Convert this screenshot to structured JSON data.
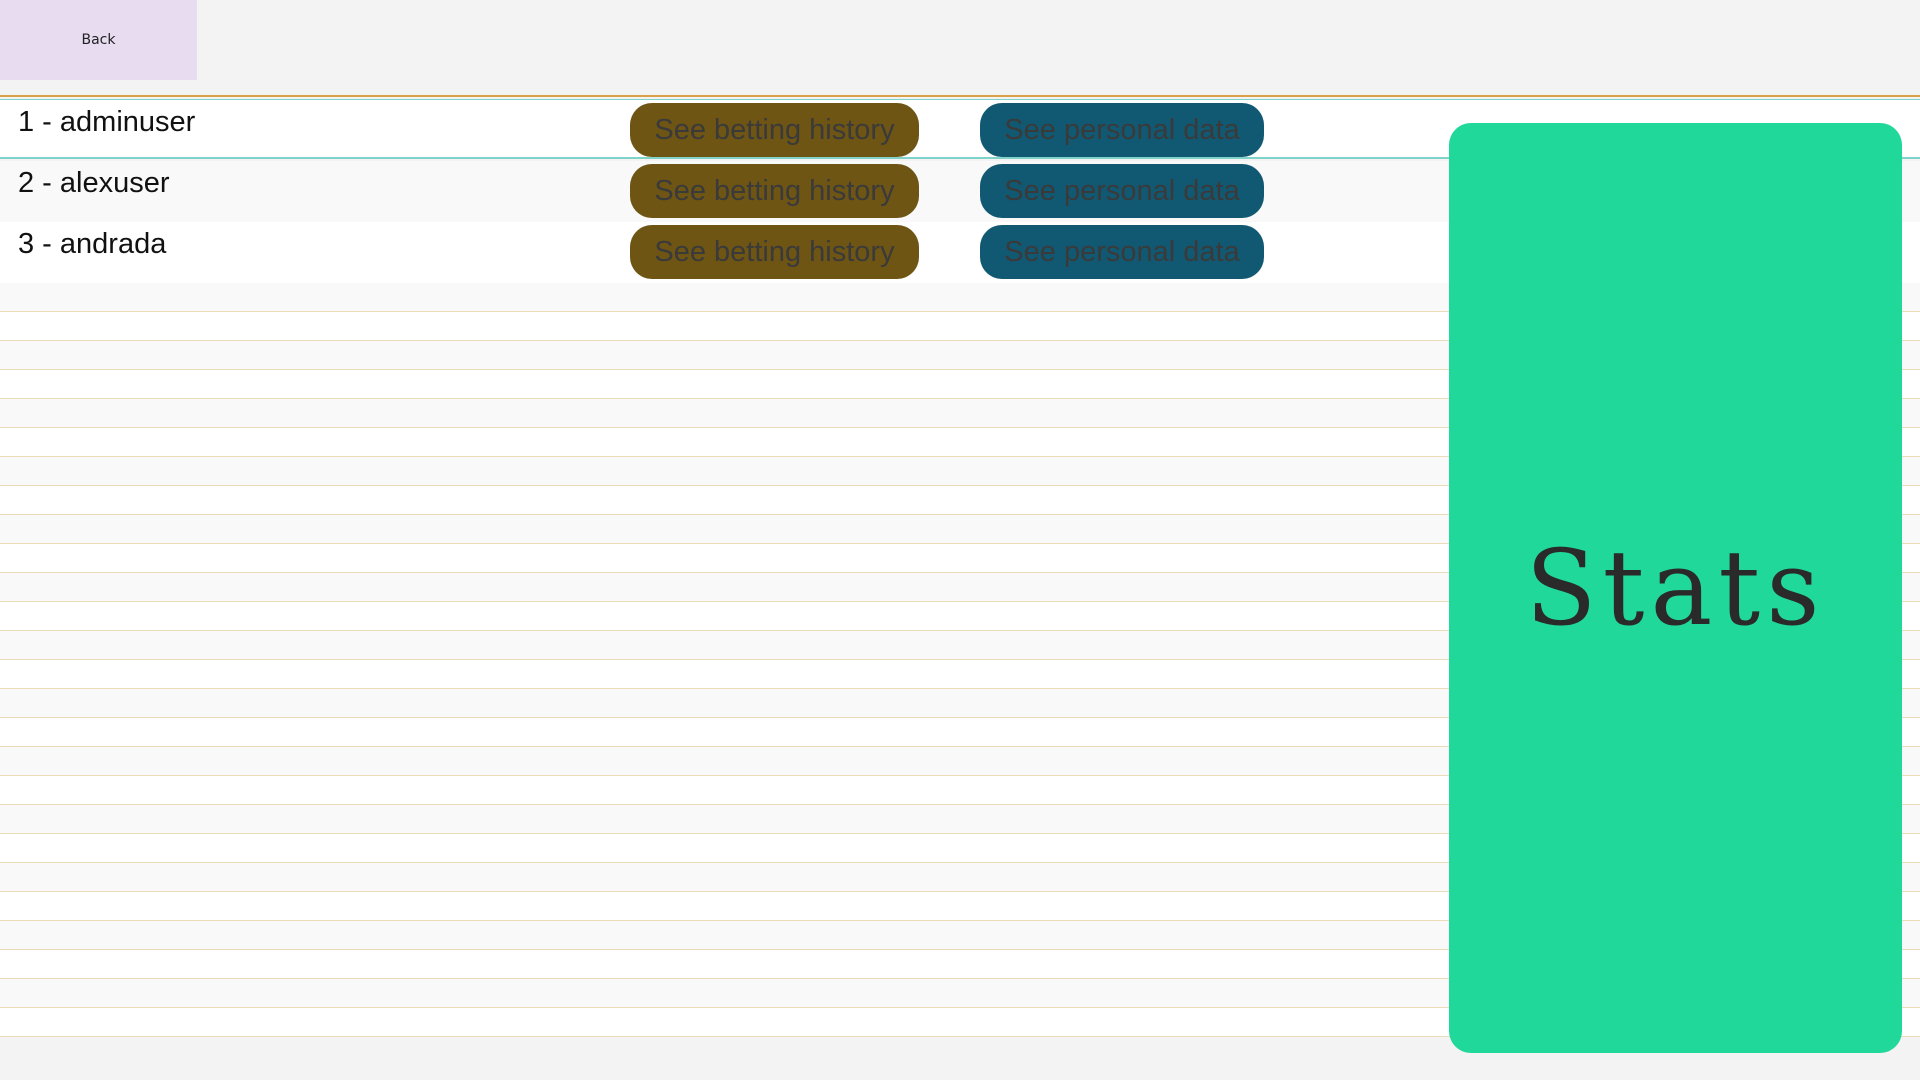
{
  "toolbar": {
    "back_label": "Back"
  },
  "users": [
    {
      "label": "1 - adminuser",
      "history_label": "See betting history",
      "personal_label": "See personal data"
    },
    {
      "label": "2 - alexuser",
      "history_label": "See betting history",
      "personal_label": "See personal data"
    },
    {
      "label": "3 - andrada",
      "history_label": "See betting history",
      "personal_label": "See personal data"
    }
  ],
  "stats": {
    "label": "Stats"
  },
  "colors": {
    "back_button": "#e8dcf1",
    "history_button": "#6e5514",
    "personal_button": "#115972",
    "stats_panel": "#20d899"
  }
}
